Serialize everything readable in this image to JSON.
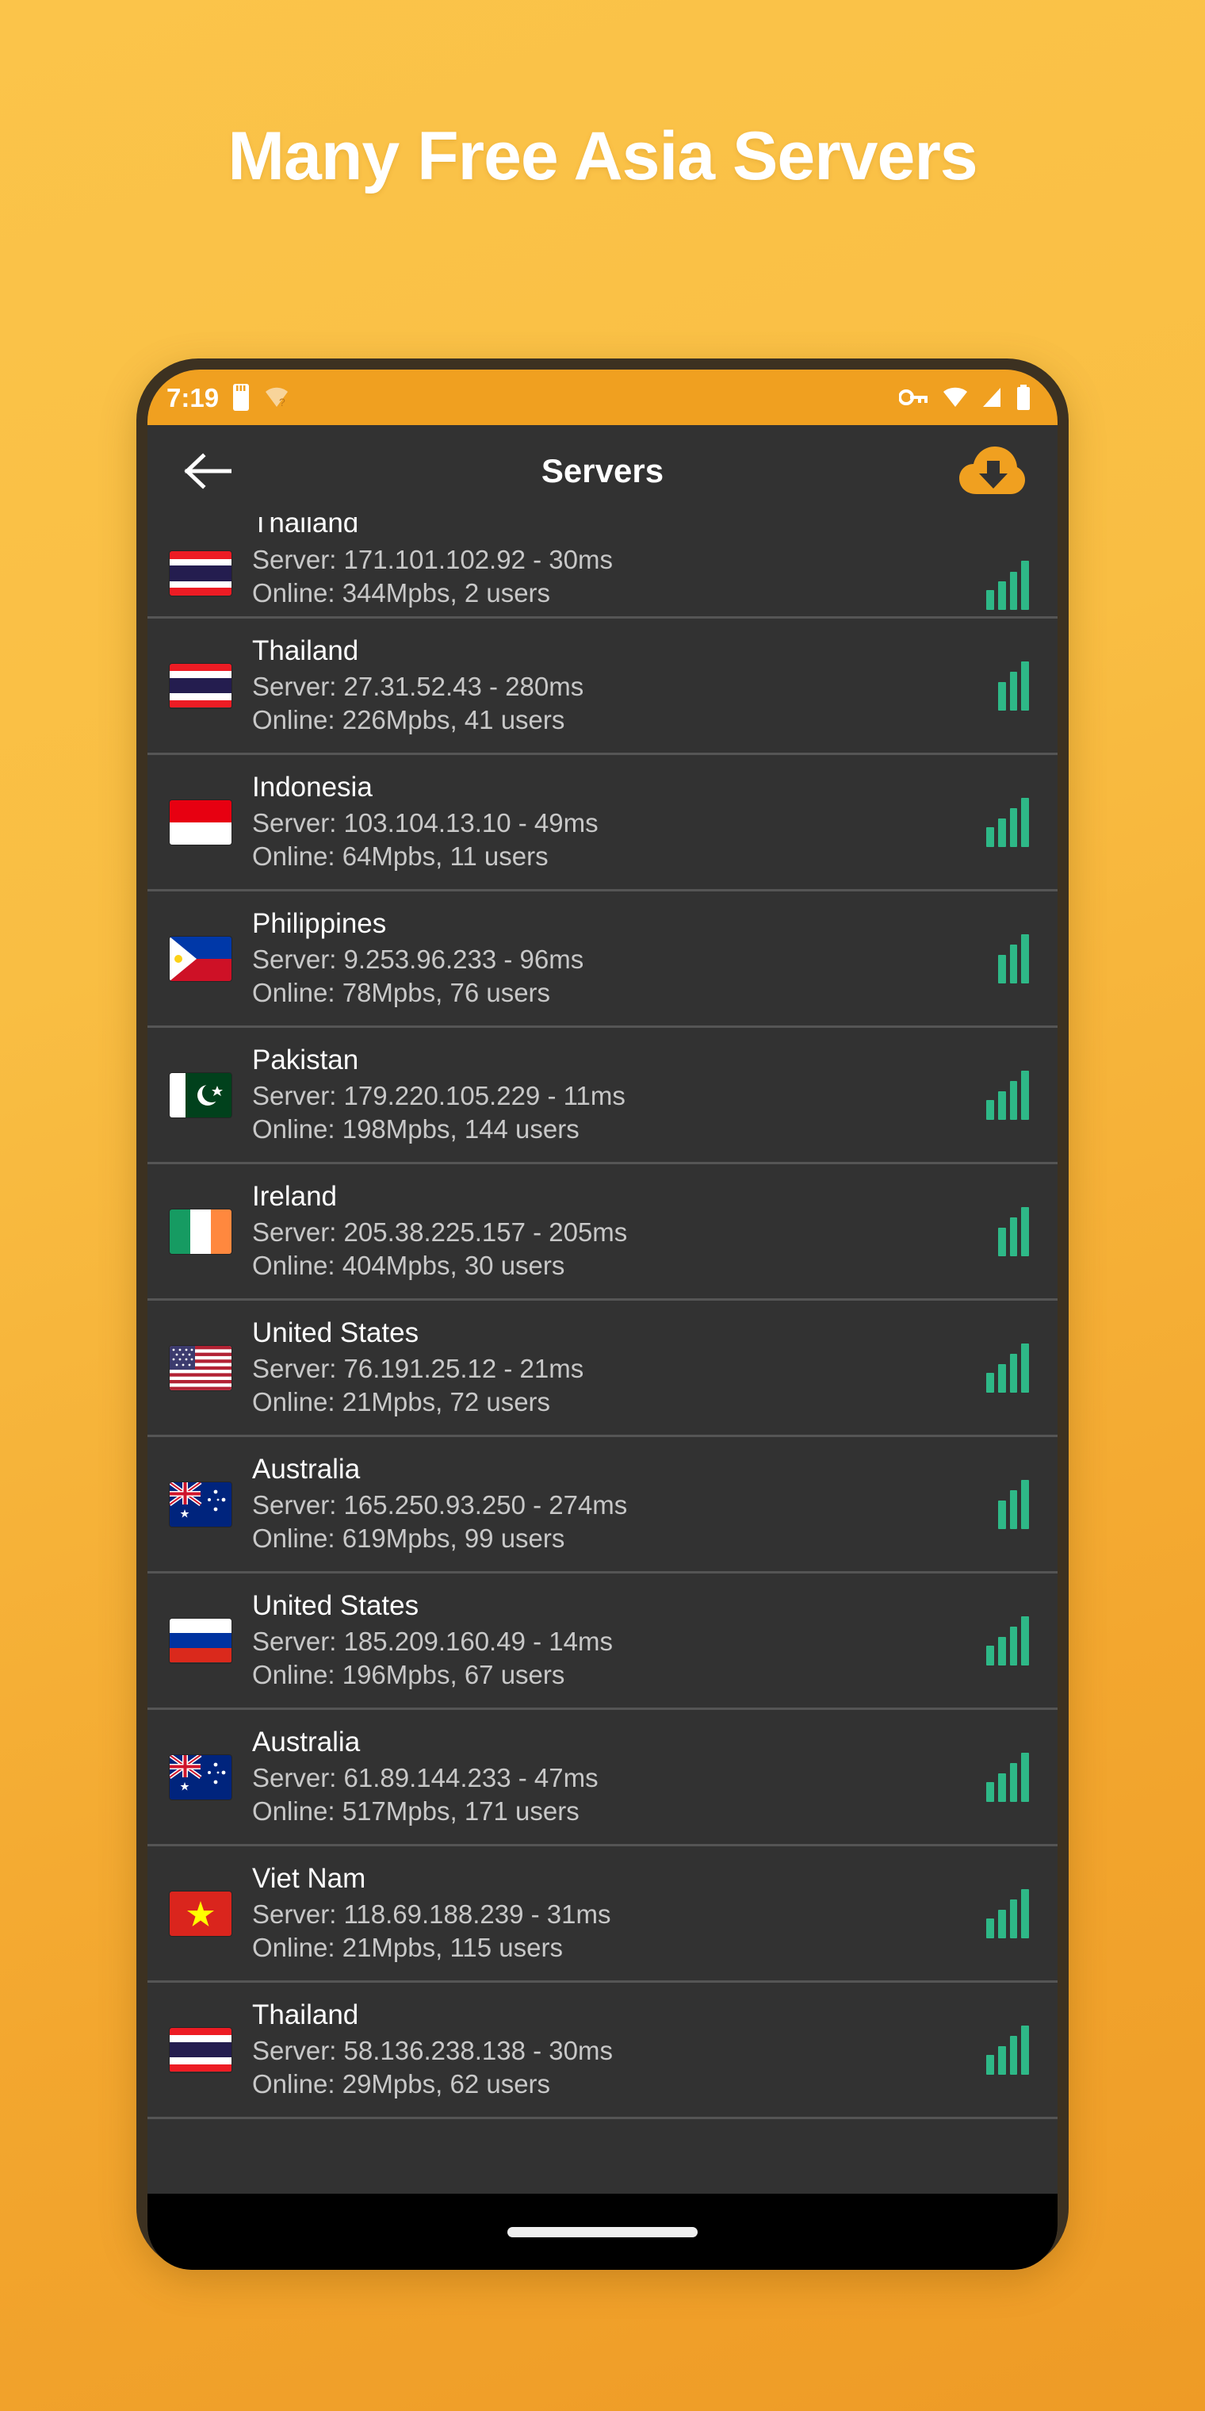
{
  "promo": {
    "headline": "Many Free Asia Servers"
  },
  "statusbar": {
    "clock": "7:19",
    "left_icons": [
      "sim-card-icon",
      "wifi-question-icon"
    ],
    "right_icons": [
      "vpn-key-icon",
      "wifi-icon",
      "cellular-signal-icon",
      "battery-icon"
    ],
    "background": "#F0A020"
  },
  "appbar": {
    "title": "Servers",
    "back_label": "Back",
    "download_label": "Download servers",
    "accent": "#F0A020"
  },
  "list": {
    "signal_color": "#2EB887",
    "rows": [
      {
        "country": "Thailand",
        "flag": "thailand",
        "server": "Server: 171.101.102.92 - 30ms",
        "online": "Online: 344Mpbs, 2 users",
        "bars": 4
      },
      {
        "country": "Thailand",
        "flag": "thailand",
        "server": "Server: 27.31.52.43 - 280ms",
        "online": "Online: 226Mpbs, 41 users",
        "bars": 3
      },
      {
        "country": "Indonesia",
        "flag": "indonesia",
        "server": "Server: 103.104.13.10 - 49ms",
        "online": "Online: 64Mpbs, 11 users",
        "bars": 4
      },
      {
        "country": "Philippines",
        "flag": "philippines",
        "server": "Server: 9.253.96.233 - 96ms",
        "online": "Online: 78Mpbs, 76 users",
        "bars": 3
      },
      {
        "country": "Pakistan",
        "flag": "pakistan",
        "server": "Server: 179.220.105.229 - 11ms",
        "online": "Online: 198Mpbs, 144 users",
        "bars": 4
      },
      {
        "country": "Ireland",
        "flag": "ireland",
        "server": "Server: 205.38.225.157 - 205ms",
        "online": "Online: 404Mpbs, 30 users",
        "bars": 3
      },
      {
        "country": "United States",
        "flag": "united-states",
        "server": "Server: 76.191.25.12 - 21ms",
        "online": "Online: 21Mpbs, 72 users",
        "bars": 4
      },
      {
        "country": "Australia",
        "flag": "australia",
        "server": "Server: 165.250.93.250 - 274ms",
        "online": "Online: 619Mpbs, 99 users",
        "bars": 3
      },
      {
        "country": "United States",
        "flag": "russia",
        "server": "Server: 185.209.160.49 - 14ms",
        "online": "Online: 196Mpbs, 67 users",
        "bars": 4
      },
      {
        "country": "Australia",
        "flag": "australia",
        "server": "Server: 61.89.144.233 - 47ms",
        "online": "Online: 517Mpbs, 171 users",
        "bars": 4
      },
      {
        "country": "Viet Nam",
        "flag": "vietnam",
        "server": "Server: 118.69.188.239 - 31ms",
        "online": "Online: 21Mpbs, 115 users",
        "bars": 4
      },
      {
        "country": "Thailand",
        "flag": "thailand",
        "server": "Server: 58.136.238.138 - 30ms",
        "online": "Online: 29Mpbs, 62 users",
        "bars": 4
      }
    ]
  },
  "navbar": {
    "gesture_pill": "home-gesture-pill"
  }
}
